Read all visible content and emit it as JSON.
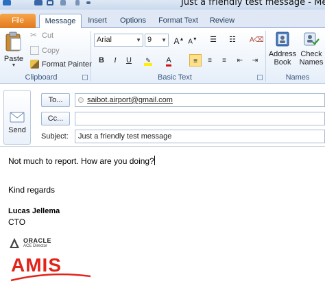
{
  "window": {
    "title": "Just a friendly test message - Message ("
  },
  "tabs": {
    "file": "File",
    "items": [
      "Message",
      "Insert",
      "Options",
      "Format Text",
      "Review"
    ],
    "active": "Message"
  },
  "ribbon": {
    "clipboard": {
      "label": "Clipboard",
      "paste": "Paste",
      "cut": "Cut",
      "copy": "Copy",
      "format_painter": "Format Painter"
    },
    "basic_text": {
      "label": "Basic Text",
      "font_name": "Arial",
      "font_size": "9",
      "bold": "B",
      "italic": "I",
      "underline": "U"
    },
    "names": {
      "label": "Names",
      "address_book_line1": "Address",
      "address_book_line2": "Book",
      "check_names_line1": "Check",
      "check_names_line2": "Names"
    }
  },
  "compose": {
    "send": "Send",
    "to_button": "To...",
    "cc_button": "Cc...",
    "subject_label": "Subject:",
    "to_value": "saibot.airport@gmail.com",
    "cc_value": "",
    "subject_value": "Just a friendly test message"
  },
  "body": {
    "line1": "Not much to report. How are you doing?",
    "line2": "Kind regards",
    "name": "Lucas Jellema",
    "role": "CTO",
    "oracle_word": "ORACLE",
    "oracle_sub": "ACE Director",
    "amis": "AMIS"
  },
  "colors": {
    "file_tab": "#e1781f",
    "amis_red": "#e2231a",
    "ribbon_label": "#3d5a80"
  }
}
